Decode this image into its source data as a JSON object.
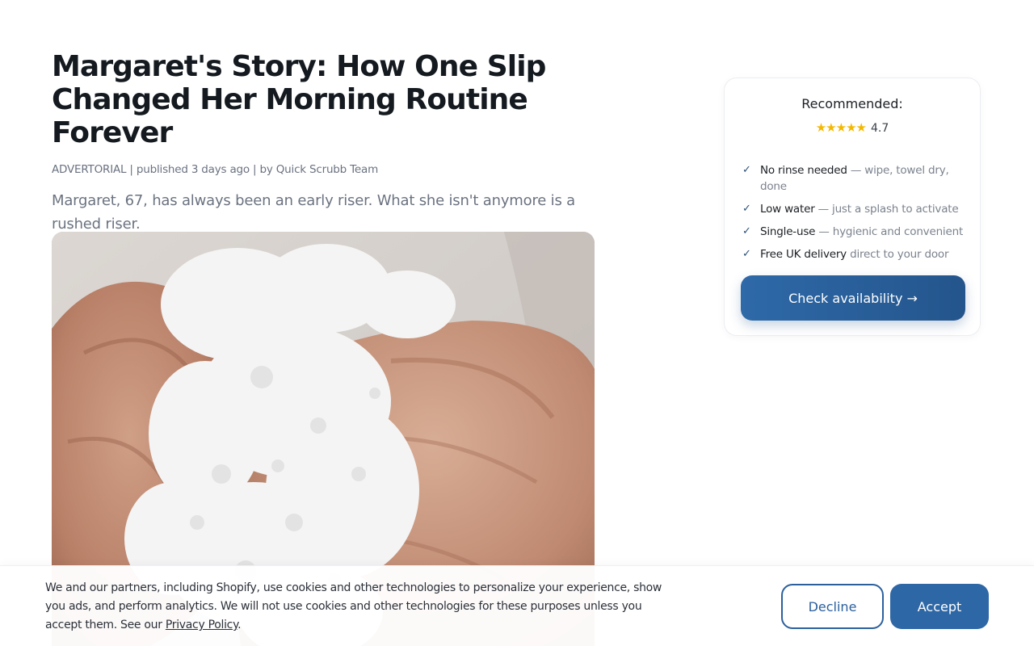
{
  "article": {
    "title": "Margaret's Story: How One Slip Changed Her Morning Routine Forever",
    "meta": "ADVERTORIAL | published 3 days ago | by Quick Scrubb Team",
    "lede": "Margaret, 67, has always been an early riser. What she isn't anymore is a rushed riser.",
    "hero_image": "photo-soapy-hands"
  },
  "sidebar": {
    "title": "Recommended:",
    "stars": "★★★★★",
    "rating": "4.7",
    "features": [
      {
        "strong": "No rinse needed",
        "soft": " — wipe, towel dry, done"
      },
      {
        "strong": "Low water",
        "soft": " — just a splash to activate"
      },
      {
        "strong": "Single-use",
        "soft": " — hygienic and convenient"
      },
      {
        "strong": "Free UK delivery",
        "soft": " direct to your door"
      }
    ],
    "cta_label": "Check availability →"
  },
  "cookie": {
    "text": "We and our partners, including Shopify, use cookies and other technologies to personalize your experience, show you ads, and perform analytics. We will not use cookies and other technologies for these purposes unless you accept them. See our ",
    "link": "Privacy Policy",
    "after": ".",
    "decline_label": "Decline",
    "accept_label": "Accept"
  },
  "colors": {
    "accent": "#2e67a6",
    "star": "#f5b800",
    "text": "#1b1f24",
    "muted": "#6b7380"
  },
  "icons": {
    "check": "check-icon",
    "star": "star-icon",
    "arrow": "arrow-right-icon"
  }
}
